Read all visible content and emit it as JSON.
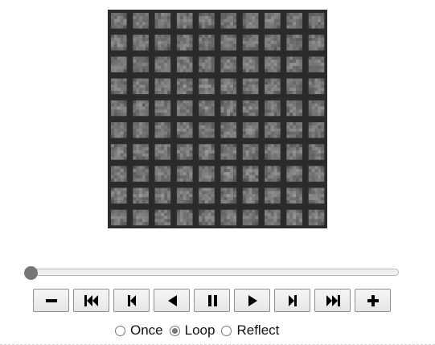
{
  "animation": {
    "frame_image": {
      "description_icon": "image-grid",
      "grid_rows": 10,
      "grid_cols": 10
    },
    "slider": {
      "position": 0
    },
    "buttons": [
      {
        "name": "decrease-speed-button",
        "icon": "minus-icon"
      },
      {
        "name": "first-frame-button",
        "icon": "skip-to-start-icon"
      },
      {
        "name": "previous-frame-button",
        "icon": "step-back-icon"
      },
      {
        "name": "play-reverse-button",
        "icon": "play-reverse-icon"
      },
      {
        "name": "pause-button",
        "icon": "pause-icon"
      },
      {
        "name": "play-button",
        "icon": "play-icon"
      },
      {
        "name": "next-frame-button",
        "icon": "step-forward-icon"
      },
      {
        "name": "last-frame-button",
        "icon": "skip-to-end-icon"
      },
      {
        "name": "increase-speed-button",
        "icon": "plus-icon"
      }
    ],
    "modes": [
      {
        "label": "Once",
        "checked": false
      },
      {
        "label": "Loop",
        "checked": true
      },
      {
        "label": "Reflect",
        "checked": false
      }
    ]
  },
  "colors": {
    "button_icon": "#000000",
    "thumb": "#767676"
  }
}
